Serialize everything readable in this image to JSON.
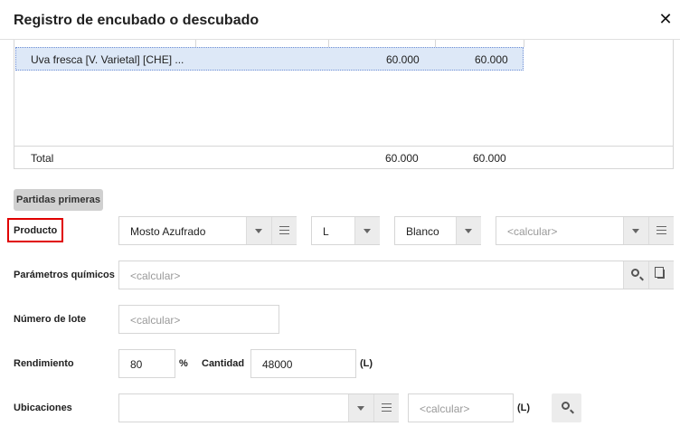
{
  "dialog": {
    "title": "Registro de encubado o descubado"
  },
  "grid": {
    "row": {
      "name": "Uva fresca [V. Varietal] [CHE] ...",
      "value1": "60.000",
      "value2": "60.000"
    },
    "total": {
      "label": "Total",
      "value1": "60.000",
      "value2": "60.000"
    }
  },
  "section": {
    "label": "Partidas primeras"
  },
  "producto": {
    "label": "Producto",
    "value": "Mosto Azufrado",
    "unit_value": "L",
    "color_value": "Blanco",
    "extra_placeholder": "<calcular>"
  },
  "parametros": {
    "label": "Parámetros químicos",
    "placeholder": "<calcular>"
  },
  "lote": {
    "label": "Número de lote",
    "placeholder": "<calcular>"
  },
  "rendimiento": {
    "label": "Rendimiento",
    "value": "80",
    "unit": "%"
  },
  "cantidad": {
    "label": "Cantidad",
    "value": "48000",
    "unit": "(L)"
  },
  "ubicaciones": {
    "label": "Ubicaciones",
    "value": "",
    "placeholder": "<calcular>",
    "unit": "(L)"
  },
  "icons": {
    "close": "close-icon",
    "caret": "chevron-down-icon",
    "menu": "list-icon",
    "search": "search-icon",
    "copy": "copy-icon"
  },
  "colors": {
    "selected_row": "#dde8f7",
    "highlight_border": "#e00000",
    "addon_bg": "#ececec"
  }
}
